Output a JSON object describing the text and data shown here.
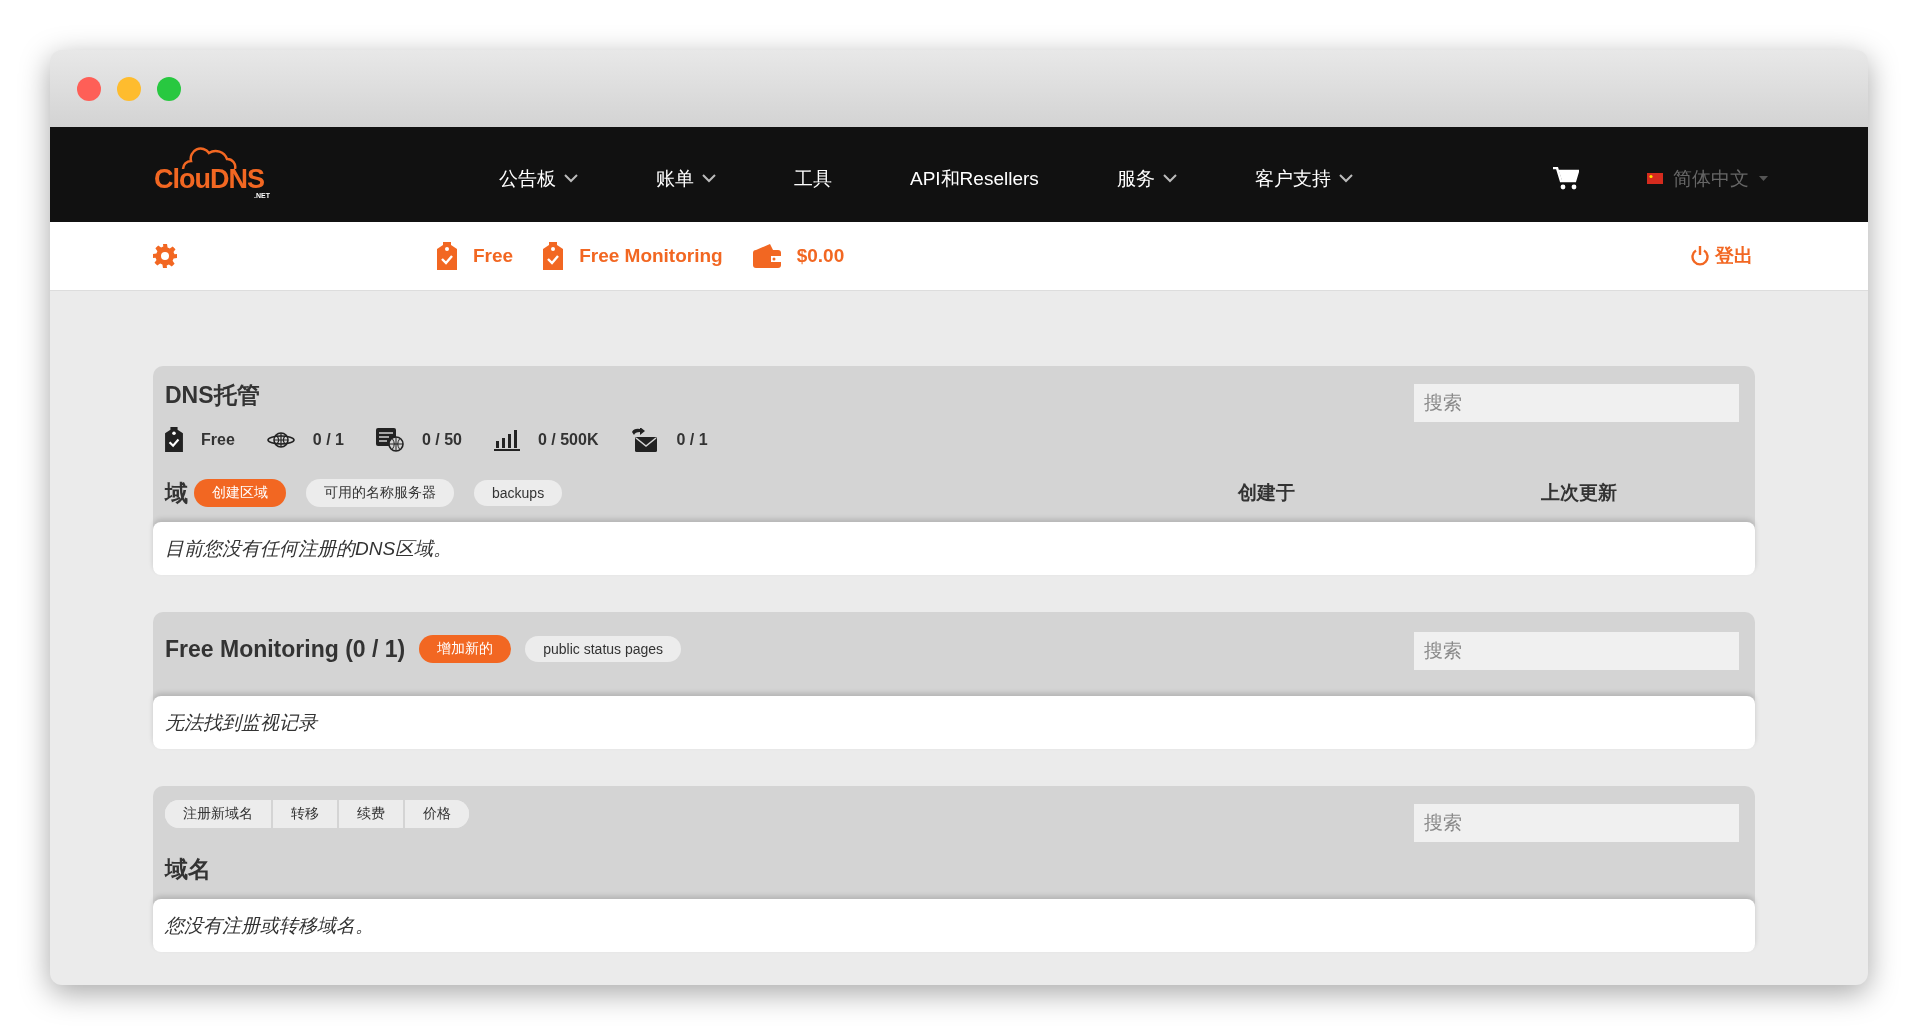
{
  "nav": {
    "logo": "ClouDNS",
    "logo_sub": ".NET",
    "items": [
      {
        "label": "公告板",
        "dropdown": true
      },
      {
        "label": "账单",
        "dropdown": true
      },
      {
        "label": "工具",
        "dropdown": false
      },
      {
        "label": "API和Resellers",
        "dropdown": false
      },
      {
        "label": "服务",
        "dropdown": true
      },
      {
        "label": "客户支持",
        "dropdown": true
      }
    ],
    "language": "简体中文"
  },
  "subbar": {
    "items": [
      {
        "kind": "plan",
        "label": "Free"
      },
      {
        "kind": "plan",
        "label": "Free Monitoring"
      },
      {
        "kind": "balance",
        "label": "$0.00"
      }
    ],
    "logout": "登出"
  },
  "dns": {
    "title": "DNS托管",
    "search": {
      "placeholder": "搜索"
    },
    "stats": [
      {
        "kind": "plan",
        "value": "Free"
      },
      {
        "kind": "zones",
        "value": "0 / 1"
      },
      {
        "kind": "records",
        "value": "0 / 50"
      },
      {
        "kind": "queries",
        "value": "0 / 500K"
      },
      {
        "kind": "mail",
        "value": "0 / 1"
      }
    ],
    "label": "域",
    "buttons": [
      {
        "label": "创建区域",
        "primary": true
      },
      {
        "label": "可用的名称服务器",
        "primary": false
      },
      {
        "label": "backups",
        "primary": false
      }
    ],
    "columns": [
      "创建于",
      "上次更新"
    ],
    "empty": "目前您没有任何注册的DNS区域。"
  },
  "monitoring": {
    "title": "Free Monitoring (0 / 1)",
    "buttons": [
      {
        "label": "增加新的",
        "primary": true
      },
      {
        "label": "public status pages",
        "primary": false
      }
    ],
    "search": {
      "placeholder": "搜索"
    },
    "empty": "无法找到监视记录"
  },
  "domains": {
    "tabs": [
      "注册新域名",
      "转移",
      "续费",
      "价格"
    ],
    "search": {
      "placeholder": "搜索"
    },
    "title": "域名",
    "empty": "您没有注册或转移域名。"
  }
}
